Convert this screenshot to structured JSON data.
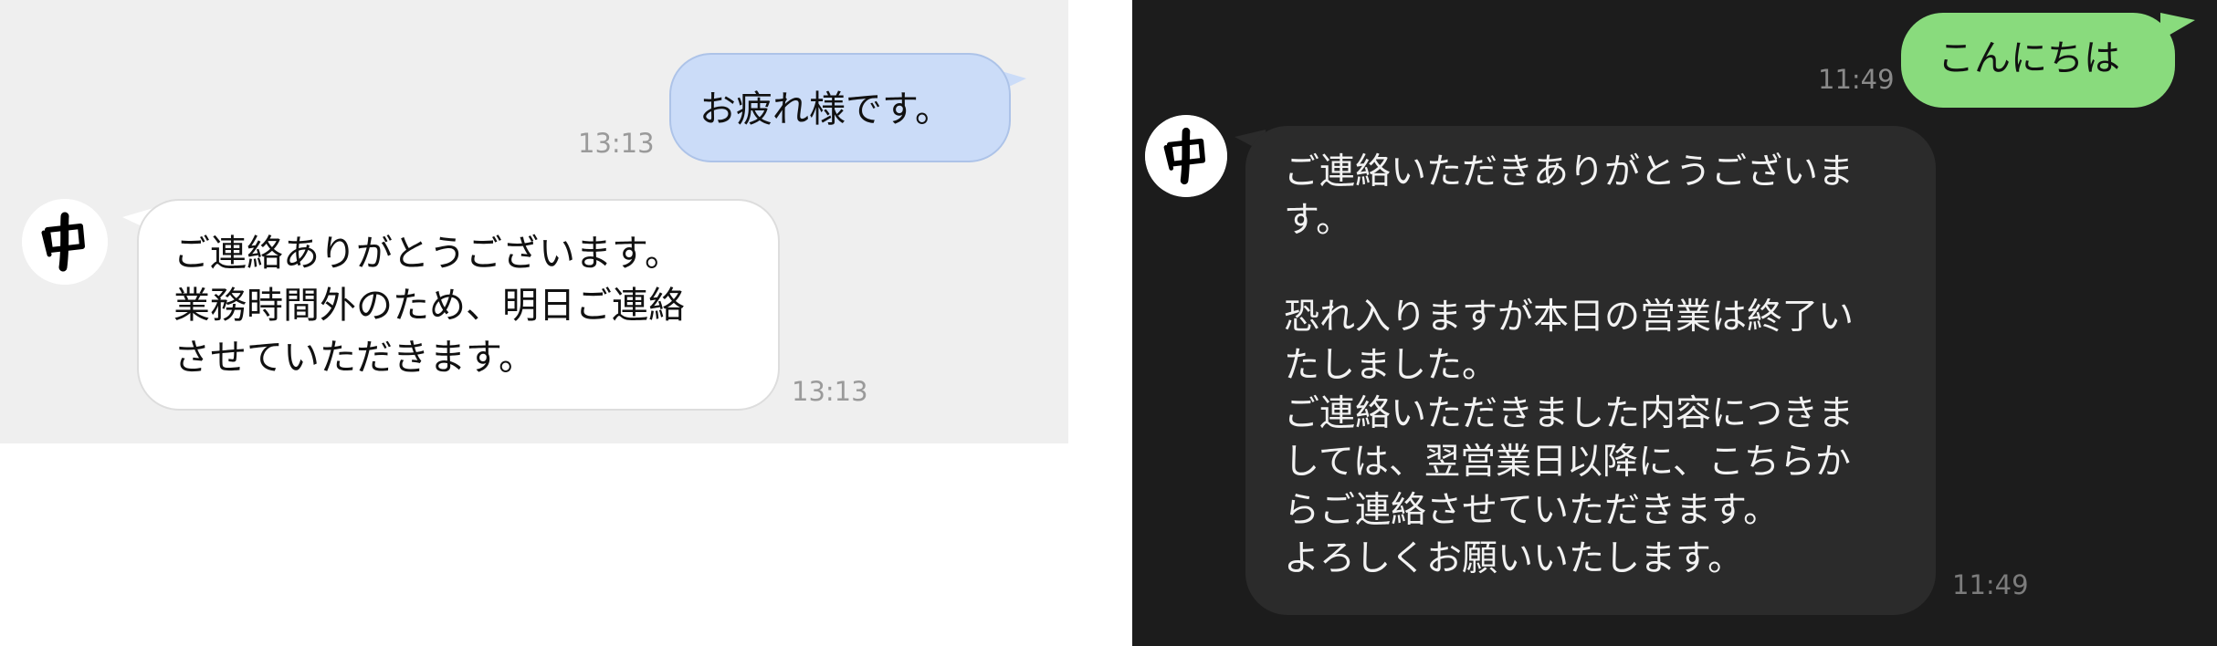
{
  "light_chat": {
    "theme_colors": {
      "background": "#efefef",
      "outgoing_bubble": "#cbdcf8",
      "incoming_bubble": "#ffffff",
      "timestamp": "#9a9a9a"
    },
    "messages": [
      {
        "direction": "outgoing",
        "text": "お疲れ様です。",
        "time": "13:13"
      },
      {
        "direction": "incoming",
        "avatar_glyph": "中",
        "text": "ご連絡ありがとうございます。\n業務時間外のため、明日ご連絡\nさせていただきます。",
        "time": "13:13"
      }
    ]
  },
  "dark_chat": {
    "theme_colors": {
      "background": "#1c1c1c",
      "outgoing_bubble": "#89db7d",
      "incoming_bubble": "#2b2b2b",
      "timestamp": "#8a8a8a"
    },
    "messages": [
      {
        "direction": "outgoing",
        "text": "こんにちは",
        "time": "11:49"
      },
      {
        "direction": "incoming",
        "avatar_glyph": "中",
        "text": "ご連絡いただきありがとうございま\nす。\n\n恐れ入りますが本日の営業は終了い\nたしました。\nご連絡いただきました内容につきま\nしては、翌営業日以降に、こちらか\nらご連絡させていただきます。\nよろしくお願いいたします。",
        "time": "11:49"
      }
    ]
  }
}
